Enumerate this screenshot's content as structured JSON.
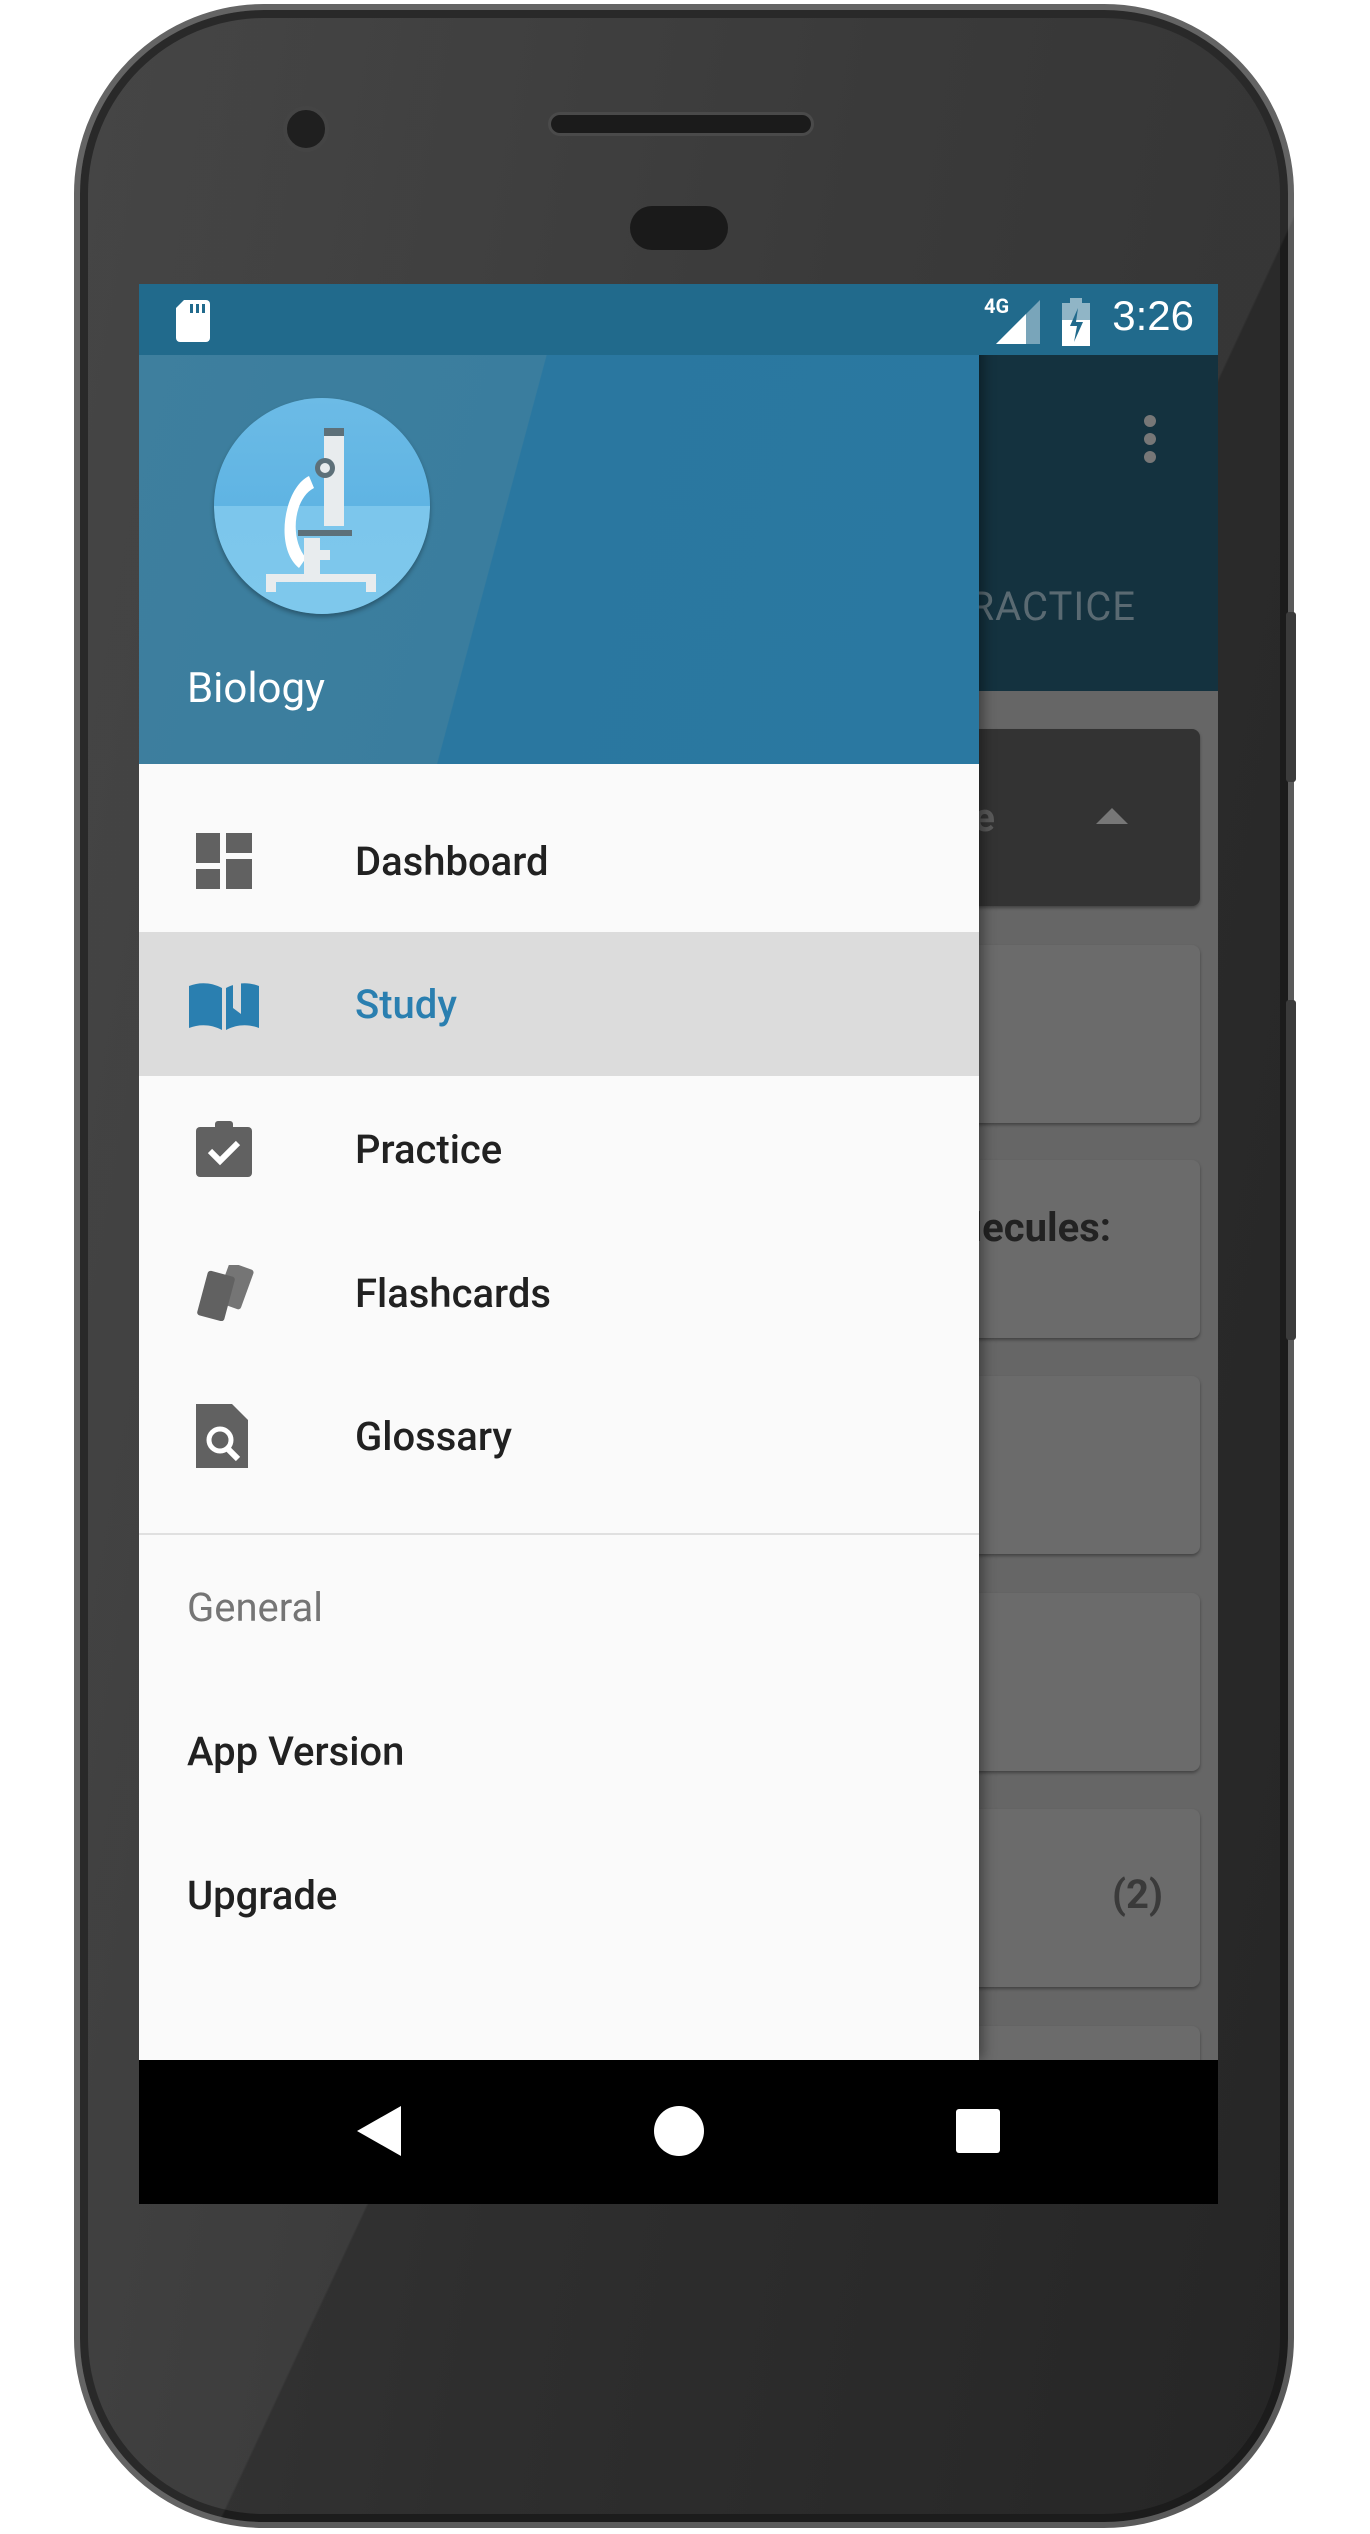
{
  "status_bar": {
    "time": "3:26",
    "network": "4G",
    "icons": [
      "sd-card-icon",
      "signal-icon",
      "battery-charging-icon"
    ]
  },
  "background_app": {
    "tab_partial": "RACTICE",
    "cards": [
      {
        "text": "ife"
      },
      {
        "text": ""
      },
      {
        "text": "olecules:"
      },
      {
        "text": ""
      },
      {
        "text": ""
      },
      {
        "text": "(2)"
      }
    ]
  },
  "drawer": {
    "header": {
      "title": "Biology",
      "logo_icon": "microscope-icon",
      "color": "#2a78a1"
    },
    "items": [
      {
        "label": "Dashboard",
        "icon": "dashboard-icon",
        "active": false
      },
      {
        "label": "Study",
        "icon": "book-icon",
        "active": true
      },
      {
        "label": "Practice",
        "icon": "clipboard-check-icon",
        "active": false
      },
      {
        "label": "Flashcards",
        "icon": "cards-icon",
        "active": false
      },
      {
        "label": "Glossary",
        "icon": "search-document-icon",
        "active": false
      }
    ],
    "section_label": "General",
    "general_items": [
      {
        "label": "App Version"
      },
      {
        "label": "Upgrade"
      }
    ],
    "accent": "#2a7fb0"
  },
  "nav_bar": {
    "buttons": [
      "back",
      "home",
      "recents"
    ]
  }
}
